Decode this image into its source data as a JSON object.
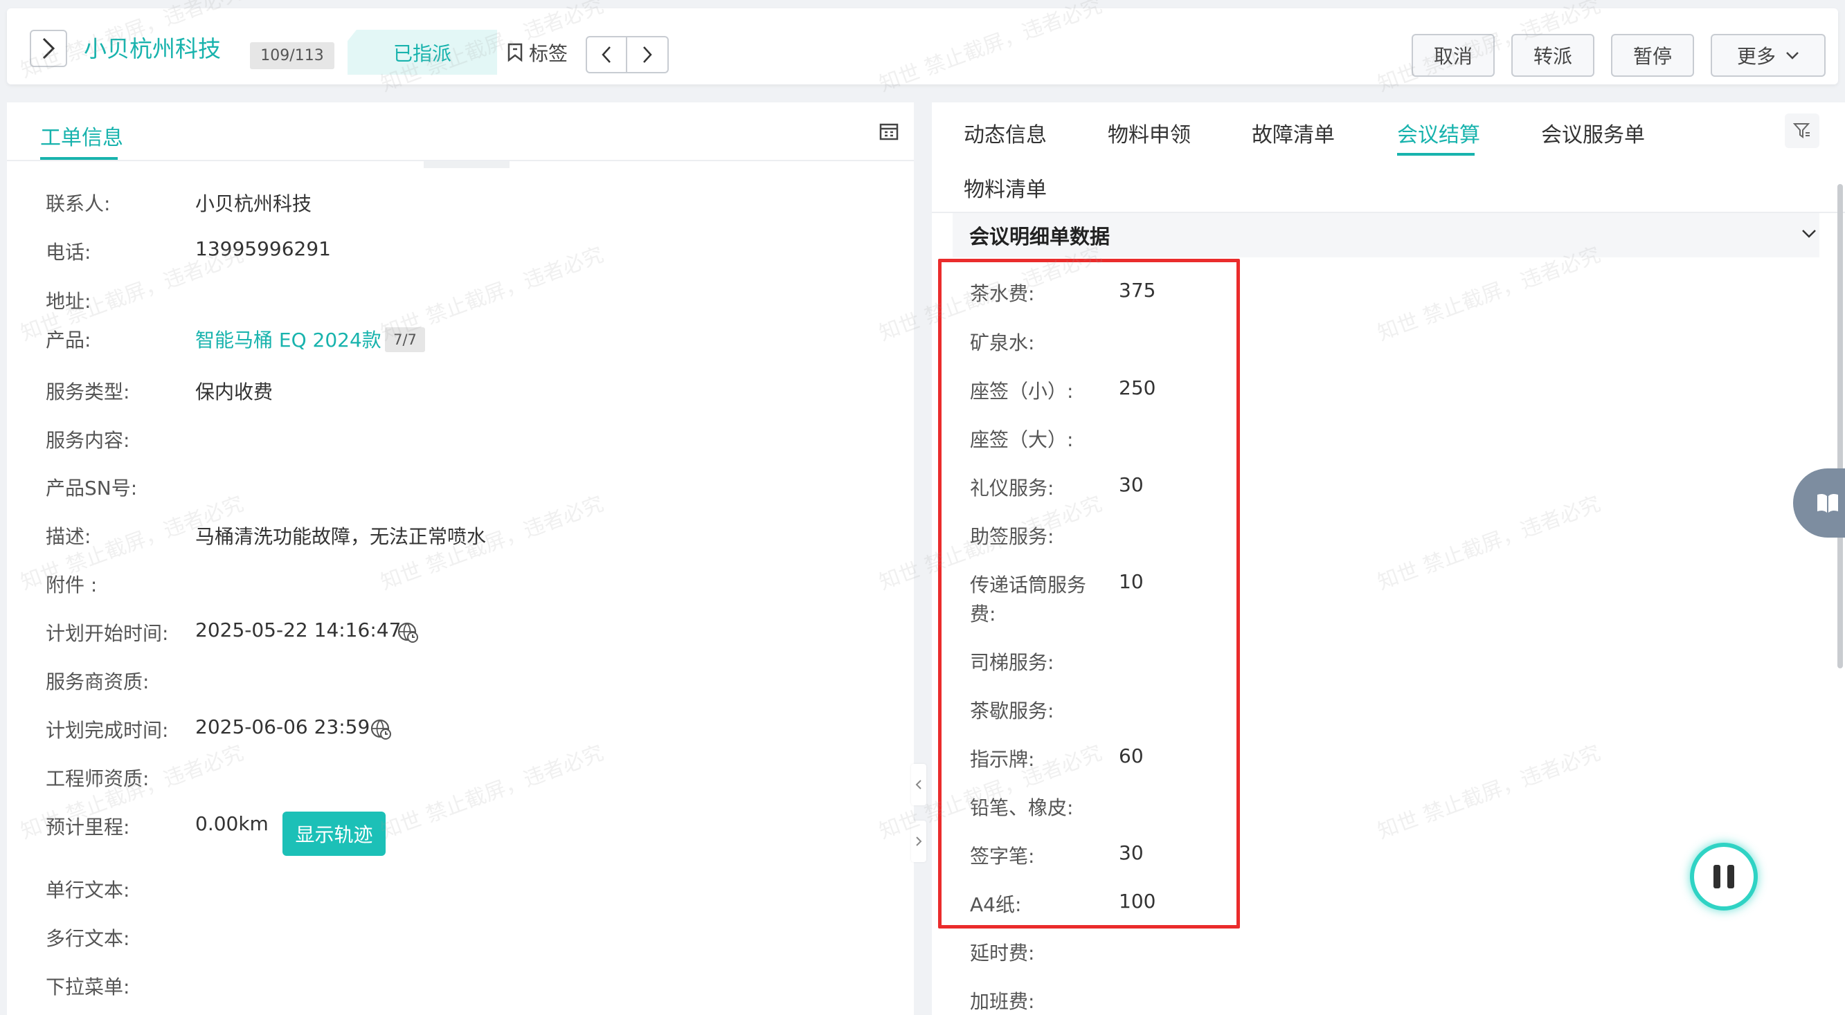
{
  "header": {
    "title": "小贝杭州科技",
    "progress": "109/113",
    "status": "已指派",
    "tag_label": "标签",
    "cancel_label": "取消",
    "transfer_label": "转派",
    "pause_label": "暂停",
    "more_label": "更多"
  },
  "left": {
    "tab_label": "工单信息",
    "fields": {
      "contact": {
        "label": "联系人:",
        "value": "小贝杭州科技"
      },
      "phone": {
        "label": "电话:",
        "value": "13995996291"
      },
      "address": {
        "label": "地址:"
      },
      "product": {
        "label": "产品:",
        "value": "智能马桶 EQ 2024款",
        "badge": "7/7"
      },
      "service_type": {
        "label": "服务类型:",
        "value": "保内收费"
      },
      "service_content": {
        "label": "服务内容:"
      },
      "product_sn": {
        "label": "产品SN号:"
      },
      "description": {
        "label": "描述:",
        "value": "马桶清洗功能故障，无法正常喷水"
      },
      "attachment": {
        "label": "附件 :"
      },
      "plan_start": {
        "label": "计划开始时间:",
        "value": "2025-05-22 14:16:47"
      },
      "provider_qual": {
        "label": "服务商资质:"
      },
      "plan_end": {
        "label": "计划完成时间:",
        "value": "2025-06-06 23:59"
      },
      "engineer_qual": {
        "label": "工程师资质:"
      },
      "mileage": {
        "label": "预计里程:",
        "value": "0.00km",
        "button": "显示轨迹"
      },
      "single_text": {
        "label": "单行文本:"
      },
      "multi_text": {
        "label": "多行文本:"
      },
      "dropdown": {
        "label": "下拉菜单:"
      }
    }
  },
  "right": {
    "tabs": [
      "动态信息",
      "物料申领",
      "故障清单",
      "会议结算",
      "会议服务单",
      "物料清单"
    ],
    "active_tab": "会议结算",
    "section_title": "会议明细单数据",
    "items": [
      {
        "label": "茶水费:",
        "value": "375"
      },
      {
        "label": "矿泉水:",
        "value": ""
      },
      {
        "label": "座签（小）:",
        "value": "250"
      },
      {
        "label": "座签（大）:",
        "value": ""
      },
      {
        "label": "礼仪服务:",
        "value": "30"
      },
      {
        "label": "助签服务:",
        "value": ""
      },
      {
        "label_line1": "传递话筒服务",
        "label_line2": "费:",
        "value": "10"
      },
      {
        "label": "司梯服务:",
        "value": ""
      },
      {
        "label": "茶歇服务:",
        "value": ""
      },
      {
        "label": "指示牌:",
        "value": "60"
      },
      {
        "label": "铅笔、橡皮:",
        "value": ""
      },
      {
        "label": "签字笔:",
        "value": "30"
      },
      {
        "label": "A4纸:",
        "value": "100"
      },
      {
        "label": "延时费:",
        "value": ""
      },
      {
        "label": "加班费:",
        "value": ""
      }
    ]
  },
  "watermark": "知世 禁止截屏，违者必究",
  "colors": {
    "accent": "#18b3ad",
    "highlight": "#ea2c2c"
  },
  "icons": [
    "chevron-right-icon",
    "bookmark-icon",
    "chevron-left-icon",
    "chevron-down-icon",
    "calendar-icon",
    "globe-clock-icon",
    "filter-icon",
    "book-icon",
    "pause-icon"
  ]
}
